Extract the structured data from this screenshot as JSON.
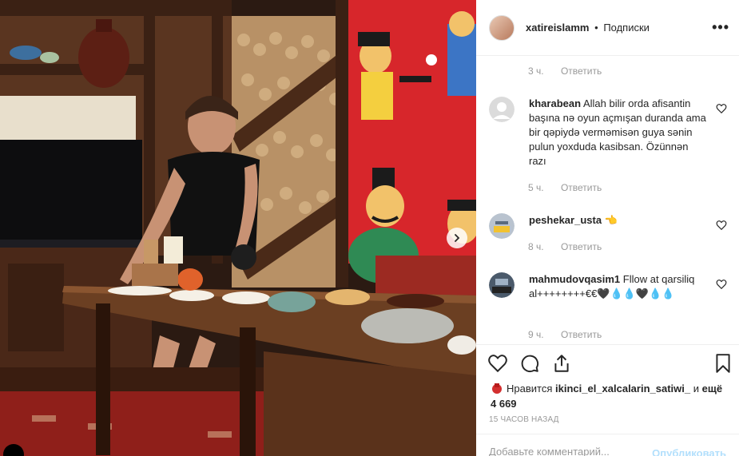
{
  "post": {
    "username": "xatireislamm",
    "separator": "•",
    "follow_label": "Подписки",
    "more_icon": "more-horizontal-icon"
  },
  "comments": [
    {
      "username": "",
      "text": "",
      "time": "3 ч.",
      "reply_label": "Ответить"
    },
    {
      "username": "kharabean",
      "text": "Allah bilir orda afisantin başına nə oyun açmışan duranda ama bir qəpiydə verməmisən guya sənin pulun yoxduda kasibsan. Özünnən razı",
      "time": "5 ч.",
      "reply_label": "Ответить"
    },
    {
      "username": "peshekar_usta",
      "text": "👈",
      "time": "8 ч.",
      "reply_label": "Ответить"
    },
    {
      "username": "mahmudovqasim1",
      "text": "Fllow at qarsiliq al++++++++€€🖤💧💧🖤💧💧",
      "time": "9 ч.",
      "reply_label": "Ответить"
    }
  ],
  "actions": {
    "like_icon": "heart-icon",
    "comment_icon": "comment-bubble-icon",
    "share_icon": "share-icon",
    "save_icon": "bookmark-icon"
  },
  "likes": {
    "prefix": "Нравится",
    "liker": "ikinci_el_xalcalarin_satiwi_",
    "conjunction": "и",
    "rest": "ещё 4 669"
  },
  "timestamp": "15 ЧАСОВ НАЗАД",
  "comment_input": {
    "placeholder": "Добавьте комментарий...",
    "publish_label": "Опубликовать"
  },
  "colors": {
    "text": "#262626",
    "muted": "#999999",
    "divider": "#efefef",
    "publish_disabled": "#b2dffc",
    "mural_red": "#d7262b"
  }
}
